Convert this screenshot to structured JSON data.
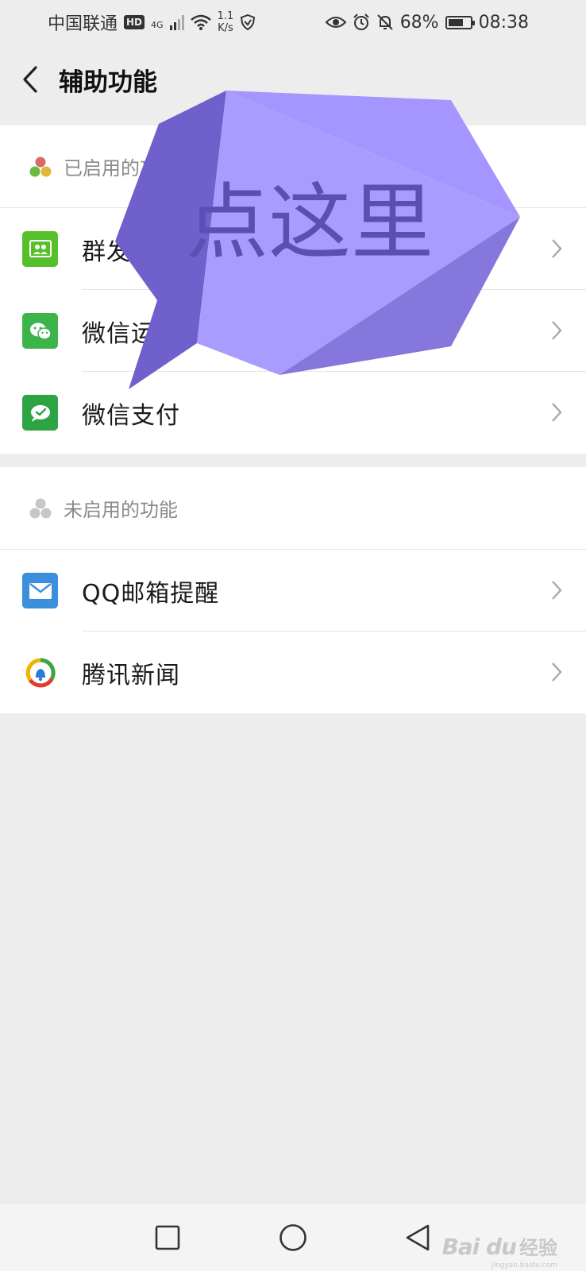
{
  "status_bar": {
    "carrier": "中国联通",
    "hd": "HD",
    "network": "4G",
    "speed_value": "1.1",
    "speed_unit": "K/s",
    "battery": "68%",
    "battery_level": 0.68,
    "time": "08:38"
  },
  "header": {
    "title": "辅助功能"
  },
  "enabled_section": {
    "label": "已启用的功能",
    "items": [
      {
        "label": "群发助手",
        "icon": "group-send-icon",
        "color": "#56c02b"
      },
      {
        "label": "微信运动",
        "icon": "wechat-sport-icon",
        "color": "#3bb44a"
      },
      {
        "label": "微信支付",
        "icon": "wechat-pay-icon",
        "color": "#2ea343"
      }
    ]
  },
  "disabled_section": {
    "label": "未启用的功能",
    "items": [
      {
        "label": "QQ邮箱提醒",
        "icon": "qq-mail-icon",
        "color": "#3b8fdd"
      },
      {
        "label": "腾讯新闻",
        "icon": "tencent-news-icon",
        "color": "#f0b400"
      }
    ]
  },
  "callout": {
    "text": "点这里",
    "color": "#9b8cf7"
  },
  "watermark": {
    "logo": "Bai du",
    "cn": "经验",
    "url": "jingyan.baidu.com"
  }
}
